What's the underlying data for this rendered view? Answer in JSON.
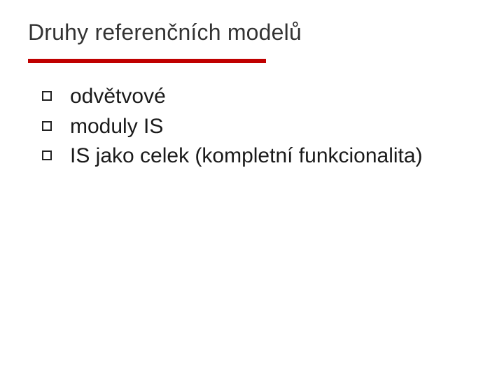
{
  "title": "Druhy referenčních modelů",
  "accent_color": "#c00000",
  "bullets": [
    "odvětvové",
    "moduly IS",
    "IS jako celek (kompletní funkcionalita)"
  ]
}
